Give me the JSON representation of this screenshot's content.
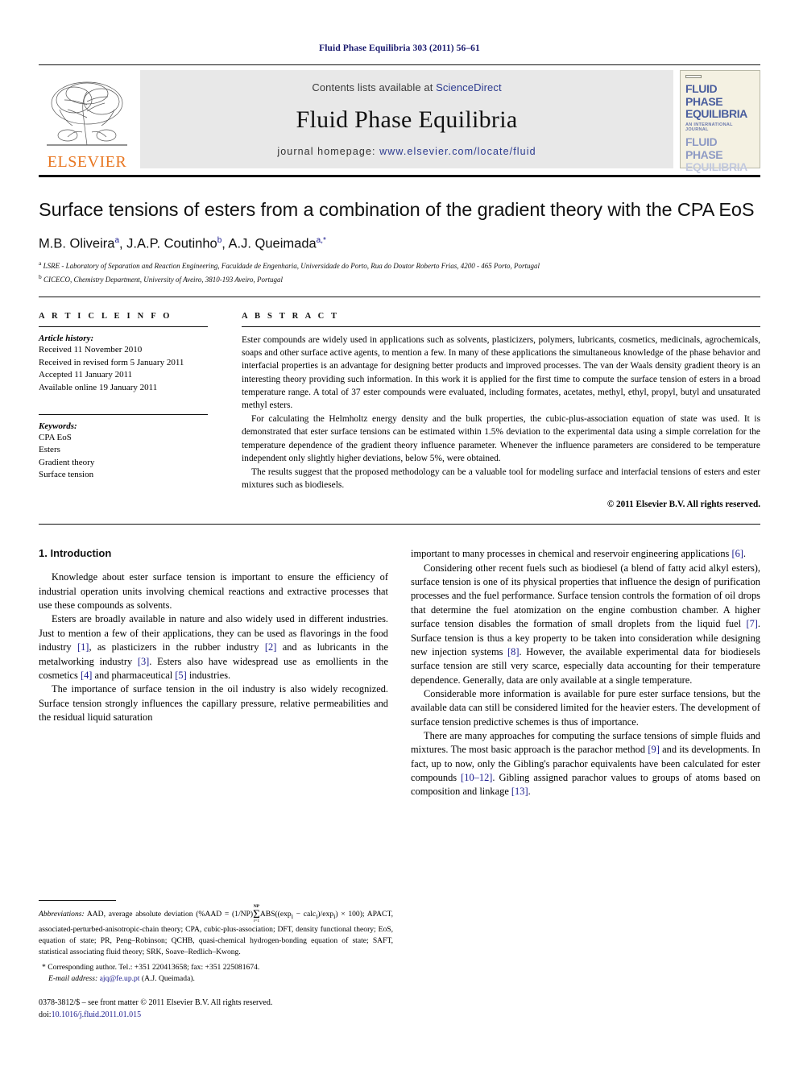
{
  "running_head": "Fluid Phase Equilibria 303 (2011) 56–61",
  "masthead": {
    "contents_prefix": "Contents lists available at ",
    "sciencedirect": "ScienceDirect",
    "journal_title": "Fluid Phase Equilibria",
    "homepage_prefix": "journal homepage: ",
    "homepage_url": "www.elsevier.com/locate/fluid",
    "publisher": "ELSEVIER",
    "publisher_color": "#e87722",
    "link_color": "#2b3a8f",
    "cover": {
      "line1": "FLUID PHASE",
      "line2": "EQUILIBRIA",
      "subtitle": "AN INTERNATIONAL JOURNAL",
      "line3": "FLUID PHASE",
      "line4": "EQUILIBRIA"
    }
  },
  "article": {
    "title": "Surface tensions of esters from a combination of the gradient theory with the CPA EoS",
    "authors": [
      {
        "name": "M.B. Oliveira",
        "marks": "a"
      },
      {
        "name": "J.A.P. Coutinho",
        "marks": "b"
      },
      {
        "name": "A.J. Queimada",
        "marks": "a,*"
      }
    ],
    "affiliations": [
      {
        "mark": "a",
        "text": "LSRE - Laboratory of Separation and Reaction Engineering, Faculdade de Engenharia, Universidade do Porto, Rua do Doutor Roberto Frias, 4200 - 465 Porto, Portugal"
      },
      {
        "mark": "b",
        "text": "CICECO, Chemistry Department, University of Aveiro, 3810-193 Aveiro, Portugal"
      }
    ]
  },
  "article_info": {
    "heading": "A R T I C L E   I N F O",
    "history_label": "Article history:",
    "history": [
      "Received 11 November 2010",
      "Received in revised form 5 January 2011",
      "Accepted 11 January 2011",
      "Available online 19 January 2011"
    ],
    "keywords_label": "Keywords:",
    "keywords": [
      "CPA EoS",
      "Esters",
      "Gradient theory",
      "Surface tension"
    ]
  },
  "abstract": {
    "heading": "A B S T R A C T",
    "paragraphs": [
      "Ester compounds are widely used in applications such as solvents, plasticizers, polymers, lubricants, cosmetics, medicinals, agrochemicals, soaps and other surface active agents, to mention a few. In many of these applications the simultaneous knowledge of the phase behavior and interfacial properties is an advantage for designing better products and improved processes. The van der Waals density gradient theory is an interesting theory providing such information. In this work it is applied for the first time to compute the surface tension of esters in a broad temperature range. A total of 37 ester compounds were evaluated, including formates, acetates, methyl, ethyl, propyl, butyl and unsaturated methyl esters.",
      "For calculating the Helmholtz energy density and the bulk properties, the cubic-plus-association equation of state was used. It is demonstrated that ester surface tensions can be estimated within 1.5% deviation to the experimental data using a simple correlation for the temperature dependence of the gradient theory influence parameter. Whenever the influence parameters are considered to be temperature independent only slightly higher deviations, below 5%, were obtained.",
      "The results suggest that the proposed methodology can be a valuable tool for modeling surface and interfacial tensions of esters and ester mixtures such as biodiesels."
    ],
    "copyright": "© 2011 Elsevier B.V. All rights reserved."
  },
  "body": {
    "section_title": "1.  Introduction",
    "left_paragraphs": [
      "Knowledge about ester surface tension is important to ensure the efficiency of industrial operation units involving chemical reactions and extractive processes that use these compounds as solvents."
    ],
    "left_p2_parts": [
      "Esters are broadly available in nature and also widely used in different industries. Just to mention a few of their applications, they can be used as flavorings in the food industry ",
      "[1]",
      ", as plasticizers in the rubber industry ",
      "[2]",
      " and as lubricants in the metalworking industry ",
      "[3]",
      ". Esters also have widespread use as emollients in the cosmetics ",
      "[4]",
      " and pharmaceutical ",
      "[5]",
      " industries."
    ],
    "left_p3": "The importance of surface tension in the oil industry is also widely recognized. Surface tension strongly influences the capillary pressure, relative permeabilities and the residual liquid saturation",
    "right_p1_parts": [
      "important to many processes in chemical and reservoir engineering applications ",
      "[6]",
      "."
    ],
    "right_p2_parts": [
      "Considering other recent fuels such as biodiesel (a blend of fatty acid alkyl esters), surface tension is one of its physical properties that influence the design of purification processes and the fuel performance. Surface tension controls the formation of oil drops that determine the fuel atomization on the engine combustion chamber. A higher surface tension disables the formation of small droplets from the liquid fuel ",
      "[7]",
      ". Surface tension is thus a key property to be taken into consideration while designing new injection systems ",
      "[8]",
      ". However, the available experimental data for biodiesels surface tension are still very scarce, especially data accounting for their temperature dependence. Generally, data are only available at a single temperature."
    ],
    "right_p3": "Considerable more information is available for pure ester surface tensions, but the available data can still be considered limited for the heavier esters. The development of surface tension predictive schemes is thus of importance.",
    "right_p4_parts": [
      "There are many approaches for computing the surface tensions of simple fluids and mixtures. The most basic approach is the parachor method ",
      "[9]",
      " and its developments. In fact, up to now, only the Gibling's parachor equivalents have been calculated for ester compounds ",
      "[10–12]",
      ". Gibling assigned parachor values to groups of atoms based on composition and linkage ",
      "[13]",
      "."
    ]
  },
  "footnotes": {
    "abbrev_label": "Abbreviations:",
    "abbrev_part1": "AAD, average absolute deviation (%AAD = (1/NP)",
    "sum_top": "NP",
    "sum_bottom": "i=1",
    "abbrev_part2": "ABS((exp",
    "abbrev_part3": " − calc",
    "abbrev_part4": ")/exp",
    "abbrev_part5": ") × 100); APACT, associated-perturbed-anisotropic-chain theory; CPA, cubic-plus-association; DFT, density functional theory; EoS, equation of state; PR, Peng–Robinson; QCHB, quasi-chemical hydrogen-bonding equation of state; SAFT, statistical associating fluid theory; SRK, Soave–Redlich–Kwong.",
    "corresponding": "* Corresponding author. Tel.: +351 220413658; fax: +351 225081674.",
    "email_label": "E-mail address:",
    "email": "ajq@fe.up.pt",
    "email_suffix": "(A.J. Queimada).",
    "issn_line": "0378-3812/$ – see front matter © 2011 Elsevier B.V. All rights reserved.",
    "doi_label": "doi:",
    "doi_value": "10.1016/j.fluid.2011.01.015"
  }
}
